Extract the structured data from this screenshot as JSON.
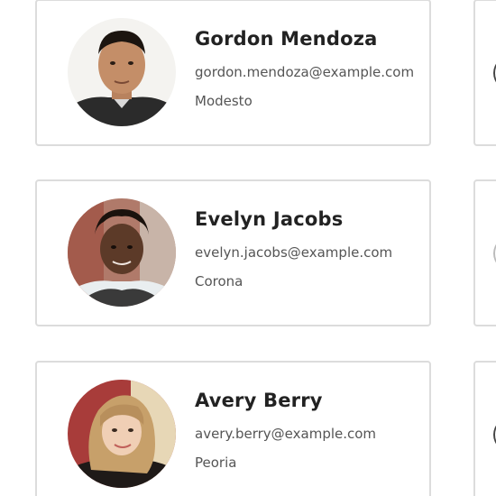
{
  "contacts": [
    {
      "name": "Gordon Mendoza",
      "email": "gordon.mendoza@example.com",
      "city": "Modesto"
    },
    {
      "name": "Evelyn Jacobs",
      "email": "evelyn.jacobs@example.com",
      "city": "Corona"
    },
    {
      "name": "Avery Berry",
      "email": "avery.berry@example.com",
      "city": "Peoria"
    }
  ],
  "colors": {
    "card_border": "#dcdcdc",
    "name_text": "#222222",
    "detail_text": "#555555"
  }
}
